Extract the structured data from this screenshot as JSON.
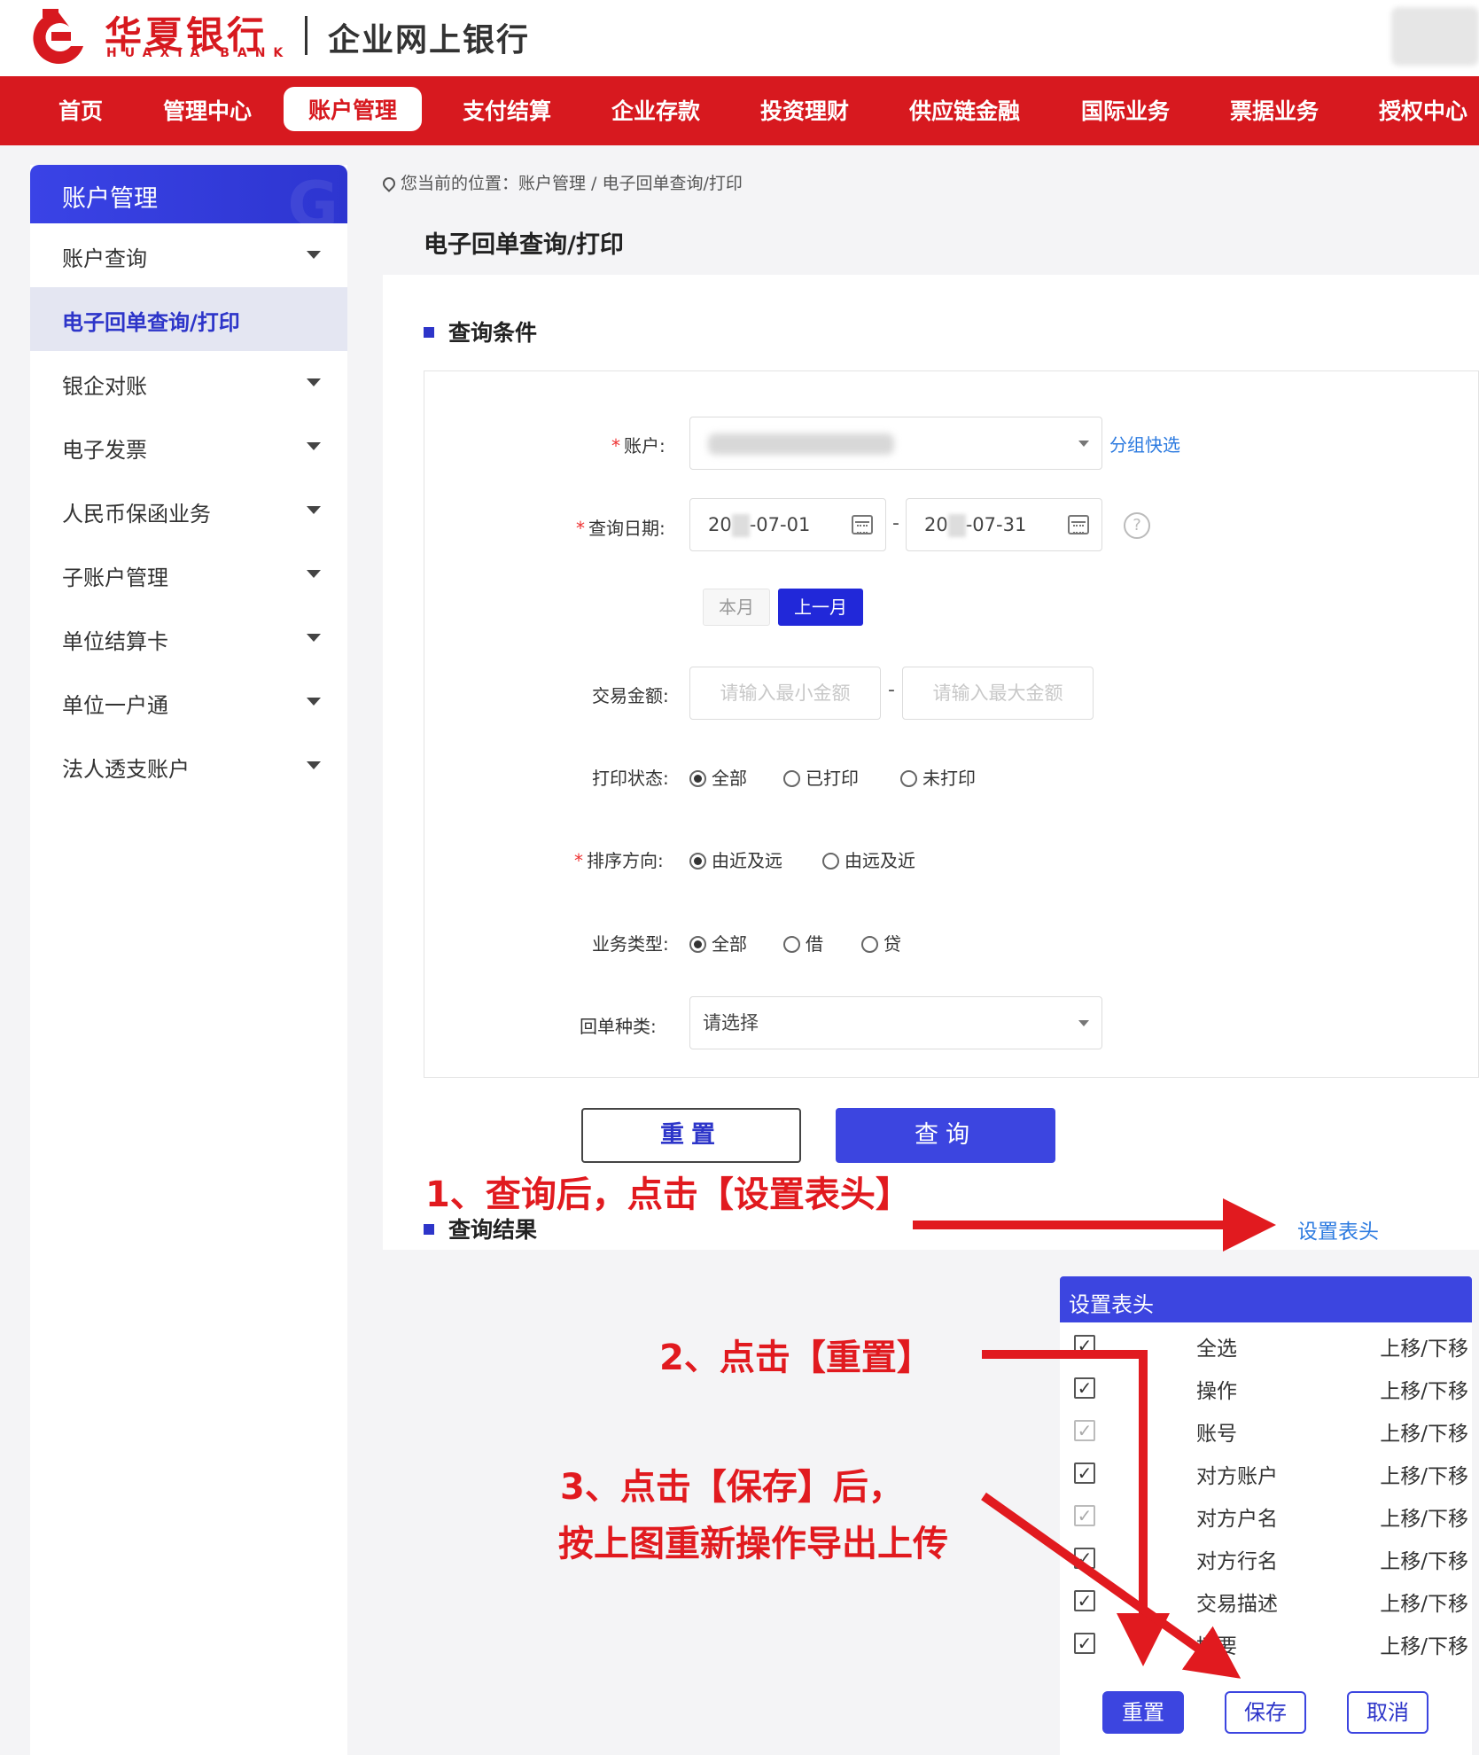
{
  "header": {
    "bank_name": "华夏银行",
    "bank_name_en": "HUAXIA BANK",
    "subtitle": "企业网上银行"
  },
  "nav": {
    "items": [
      "首页",
      "管理中心",
      "账户管理",
      "支付结算",
      "企业存款",
      "投资理财",
      "供应链金融",
      "国际业务",
      "票据业务",
      "授权中心"
    ],
    "active_index": 2
  },
  "sidebar": {
    "title": "账户管理",
    "items": [
      "账户查询",
      "电子回单查询/打印",
      "银企对账",
      "电子发票",
      "人民币保函业务",
      "子账户管理",
      "单位结算卡",
      "单位一户通",
      "法人透支账户"
    ],
    "active_index": 1
  },
  "breadcrumb": "您当前的位置：账户管理 / 电子回单查询/打印",
  "page_title": "电子回单查询/打印",
  "query": {
    "section_title": "查询条件",
    "account_label": "账户:",
    "group_select": "分组快选",
    "date_label": "查询日期:",
    "date_start_prefix": "20",
    "date_start_suffix": "-07-01",
    "date_end_prefix": "20",
    "date_end_suffix": "-07-31",
    "date_sep": "-",
    "this_month": "本月",
    "last_month": "上一月",
    "amount_label": "交易金额:",
    "amount_min_placeholder": "请输入最小金额",
    "amount_max_placeholder": "请输入最大金额",
    "amount_sep": "-",
    "print_status_label": "打印状态:",
    "print_status_options": [
      "全部",
      "已打印",
      "未打印"
    ],
    "sort_label": "排序方向:",
    "sort_options": [
      "由近及远",
      "由远及近"
    ],
    "biz_type_label": "业务类型:",
    "biz_type_options": [
      "全部",
      "借",
      "贷"
    ],
    "receipt_type_label": "回单种类:",
    "receipt_type_value": "请选择",
    "reset_button": "重置",
    "search_button": "查询"
  },
  "results": {
    "section_title": "查询结果",
    "set_header_link": "设置表头"
  },
  "column_popup": {
    "title": "设置表头",
    "select_all": "全选",
    "move_label": "上移/下移",
    "columns": [
      {
        "name": "操作",
        "checked": true,
        "disabled": false
      },
      {
        "name": "账号",
        "checked": true,
        "disabled": true
      },
      {
        "name": "对方账户",
        "checked": true,
        "disabled": false
      },
      {
        "name": "对方户名",
        "checked": true,
        "disabled": true
      },
      {
        "name": "对方行名",
        "checked": true,
        "disabled": false
      },
      {
        "name": "交易描述",
        "checked": true,
        "disabled": false
      },
      {
        "name": "摘要",
        "checked": true,
        "disabled": false
      }
    ],
    "reset_button": "重置",
    "save_button": "保存",
    "cancel_button": "取消"
  },
  "annotations": {
    "step1": "1、查询后，点击【设置表头】",
    "step2": "2、点击【重置】",
    "step3_line1": "3、点击【保存】后，",
    "step3_line2": "按上图重新操作导出上传"
  },
  "colors": {
    "brand_red": "#d7191f",
    "primary_blue": "#3c45e0",
    "annotation_red": "#e11a1f",
    "link_blue": "#2d7be0"
  }
}
